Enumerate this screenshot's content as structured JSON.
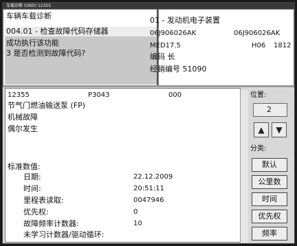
{
  "window": {
    "title": "车载诊断 (OBD) 12355"
  },
  "header": {
    "app_name": "车辆车载诊断",
    "function": "004.01 - 检查故障代码存储器",
    "status_line1": "成功执行该功能",
    "status_line2": "3 是否检测到故障代码?",
    "ecu": "01 - 发动机电子装置",
    "part_no_left": "06J906026AK",
    "part_no_right": "06J906026AK",
    "ecu_type": "MED17.5",
    "version1": "H06",
    "version2": "1812",
    "coding": "编码 长",
    "dealer": "经销编号 51090"
  },
  "fault": {
    "code": "12355",
    "pcode": "P3043",
    "status": "000",
    "component": "节气门燃油输送泵 (FP)",
    "type": "机械故障",
    "occurrence": "偶尔发生"
  },
  "freeze_frame": {
    "heading": "标准数值:",
    "rows": [
      {
        "label": "日期:",
        "value": "22.12.2009"
      },
      {
        "label": "时间:",
        "value": "20:51:11"
      },
      {
        "label": "里程表读取:",
        "value": "0047946"
      },
      {
        "label": "优先权:",
        "value": "0"
      },
      {
        "label": "故障频率计数器:",
        "value": "10"
      },
      {
        "label": "未学习计数器/驱动循环:",
        "value": ""
      }
    ]
  },
  "side_panel": {
    "position_label": "位置:",
    "position_value": "2",
    "up_arrow": "▲",
    "down_arrow": "▼",
    "category_label": "分类:",
    "buttons": [
      "默认",
      "公里数",
      "时间",
      "优先权",
      "频率"
    ]
  }
}
